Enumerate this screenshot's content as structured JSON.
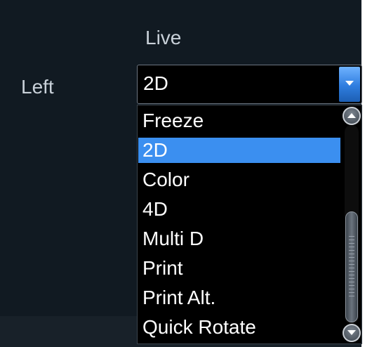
{
  "column_heading": "Live",
  "row_label": "Left",
  "combo": {
    "value": "2D"
  },
  "dropdown": {
    "options": [
      "Freeze",
      "2D",
      "Color",
      "4D",
      "Multi D",
      "Print",
      "Print Alt.",
      "Quick Rotate"
    ],
    "selected_index": 1
  },
  "colors": {
    "panel_background": "#111a22",
    "list_background": "#000000",
    "selection": "#3b8ff0",
    "text": "#ffffff",
    "label_text": "#c9d1d9"
  },
  "icons": {
    "combo_button": "chevron-down-icon",
    "scroll_up": "scroll-up-icon",
    "scroll_down": "scroll-down-icon"
  }
}
